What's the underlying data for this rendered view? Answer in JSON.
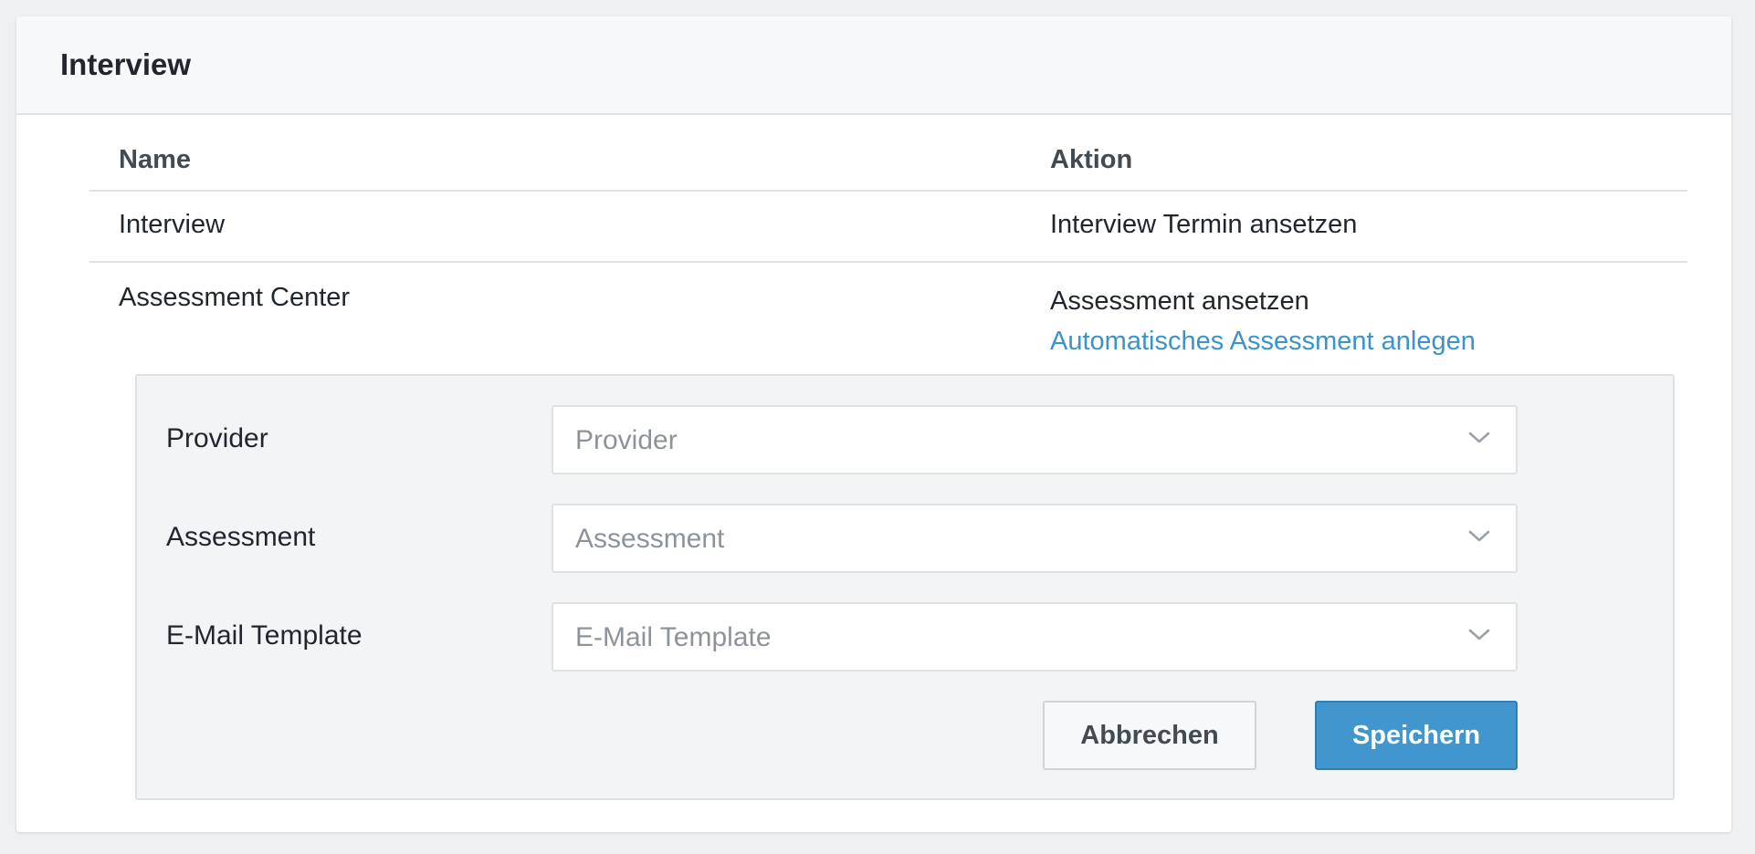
{
  "card": {
    "title": "Interview"
  },
  "table": {
    "headers": {
      "name": "Name",
      "action": "Aktion"
    },
    "rows": [
      {
        "name": "Interview",
        "action": "Interview Termin ansetzen"
      },
      {
        "name": "Assessment Center",
        "action": "Assessment ansetzen",
        "link": "Automatisches Assessment anlegen"
      }
    ]
  },
  "form": {
    "fields": [
      {
        "label": "Provider",
        "placeholder": "Provider",
        "icon": "chevron-down-icon"
      },
      {
        "label": "Assessment",
        "placeholder": "Assessment",
        "icon": "chevron-down-icon"
      },
      {
        "label": "E-Mail Template",
        "placeholder": "E-Mail Template",
        "icon": "chevron-down-icon"
      }
    ],
    "cancel_label": "Abbrechen",
    "save_label": "Speichern"
  },
  "colors": {
    "page_background": "#eff0f2",
    "header_background": "#f7f8f9",
    "panel_background": "#f3f4f6",
    "border": "#dde1e5",
    "link": "#3a93cc",
    "primary": "#4096cd",
    "text": "#1f262d",
    "placeholder": "#8c939a"
  }
}
